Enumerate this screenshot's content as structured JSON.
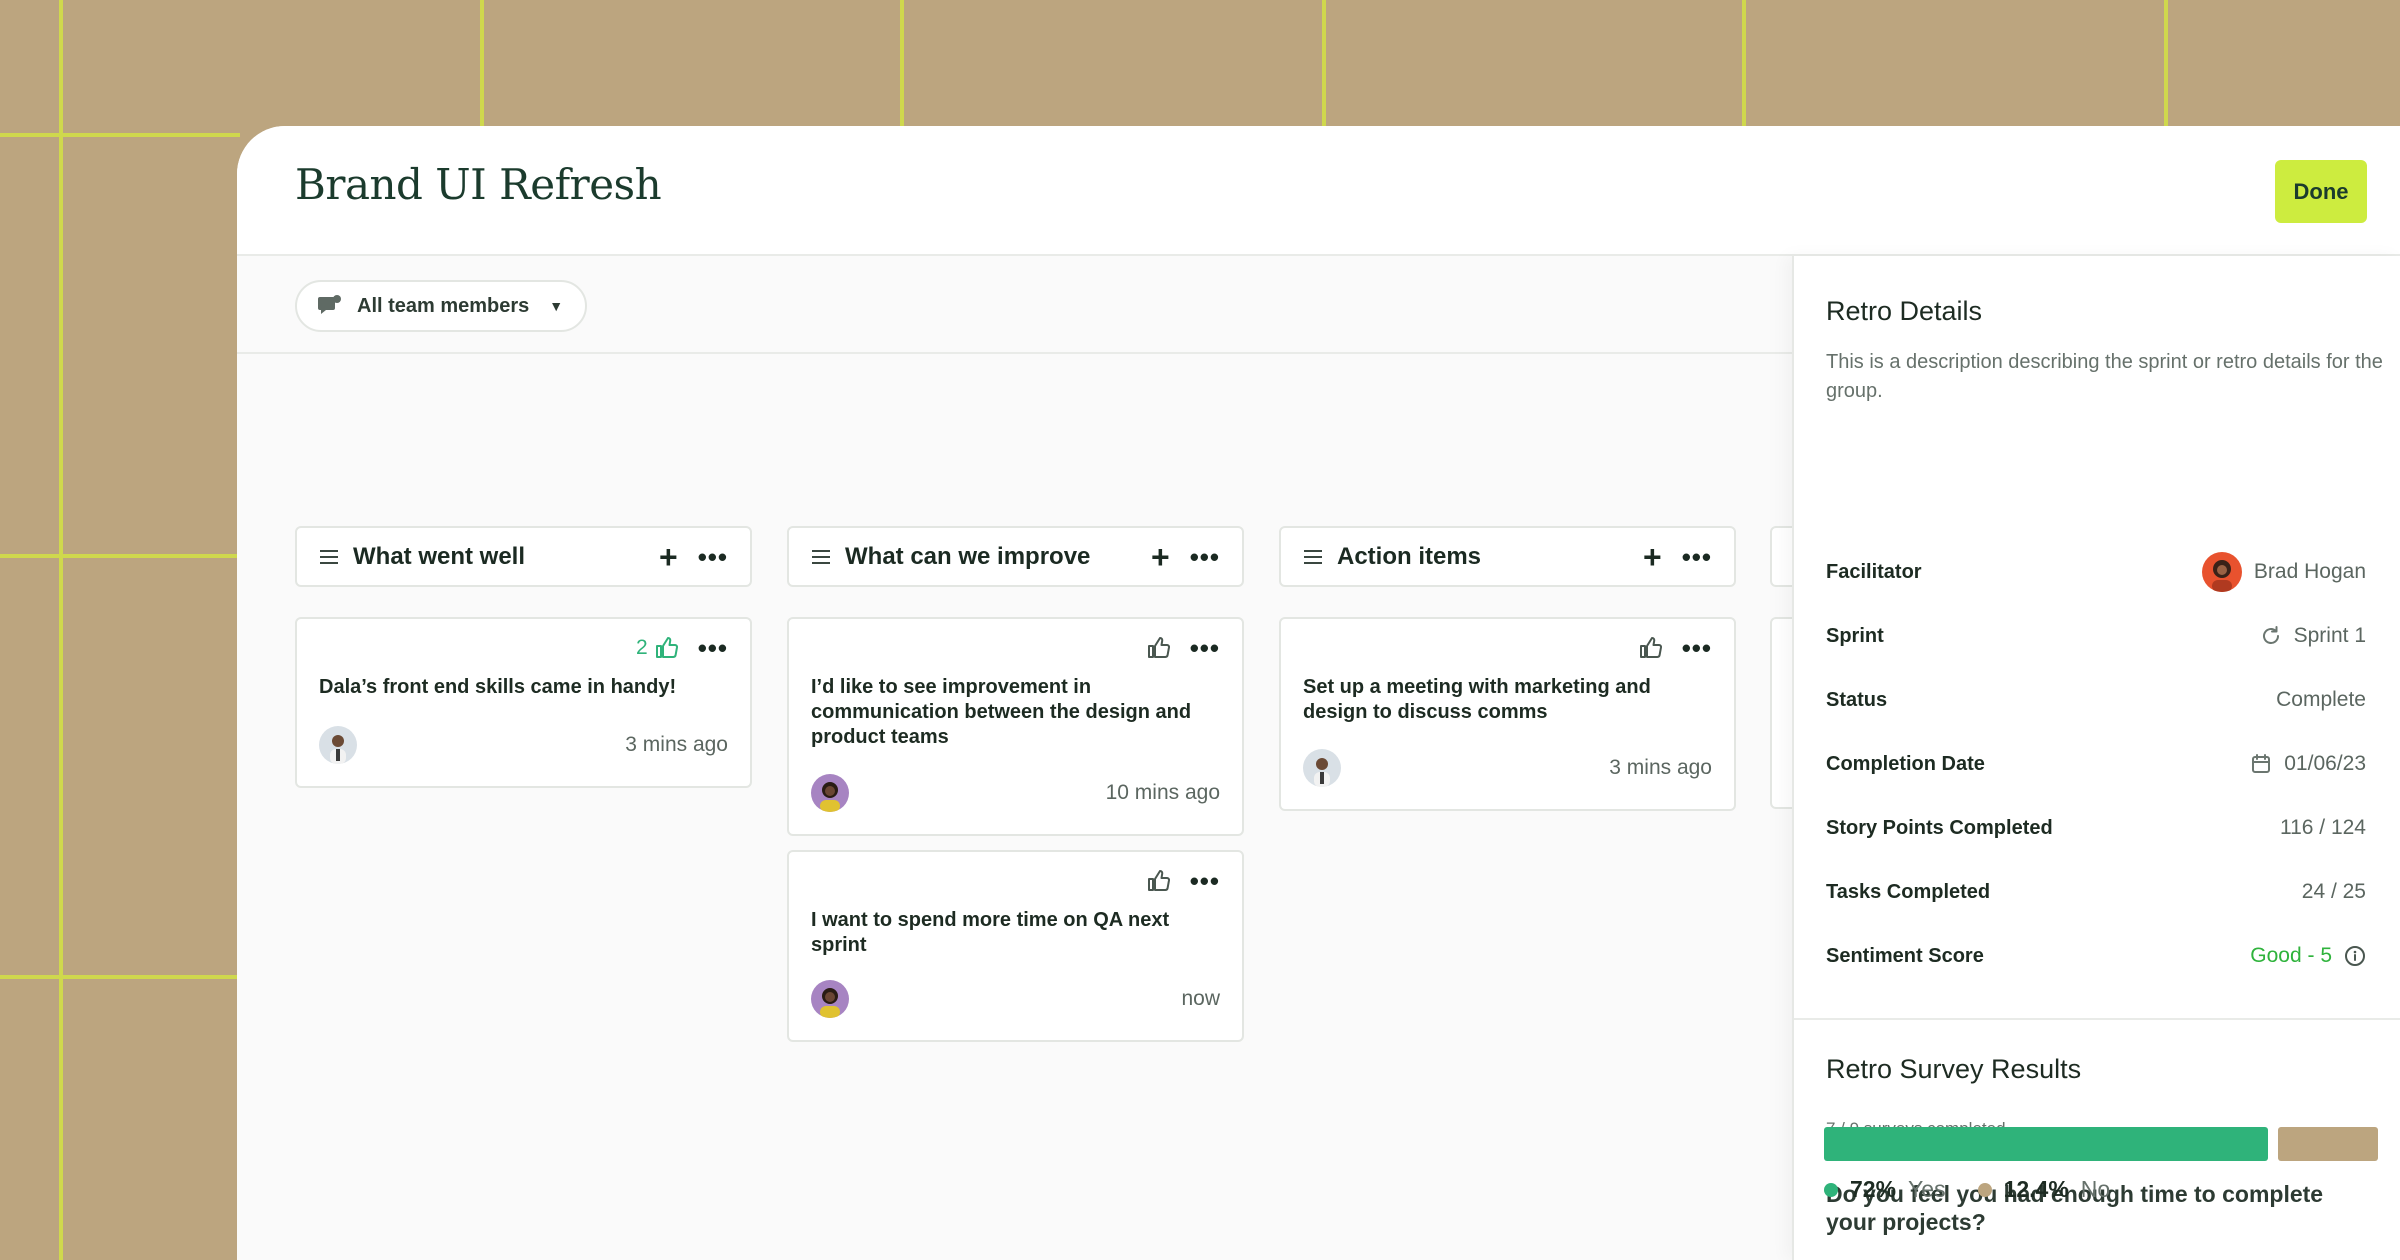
{
  "board": {
    "title": "Brand UI Refresh",
    "done_label": "Done",
    "filter_label": "All team members"
  },
  "columns": [
    {
      "title": "What went well",
      "cards": [
        {
          "text": "Dala’s front end skills came in handy!",
          "time": "3 mins ago",
          "likes": "2",
          "avatar": "man-light-shirt"
        }
      ]
    },
    {
      "title": "What can we improve",
      "cards": [
        {
          "text": "I’d like to see improvement in communication between the design and product teams",
          "time": "10 mins ago",
          "likes": "",
          "avatar": "woman-purple-bg"
        },
        {
          "text": "I want to spend more time on QA next sprint",
          "time": "now",
          "likes": "",
          "avatar": "woman-purple-bg"
        }
      ]
    },
    {
      "title": "Action items",
      "cards": [
        {
          "text": "Set up a meeting with marketing and design to discuss comms",
          "time": "3 mins ago",
          "likes": "",
          "avatar": "man-light-shirt"
        }
      ]
    }
  ],
  "retro_details": {
    "title": "Retro Details",
    "description": "This is a description describing the sprint or retro details for the group.",
    "rows": [
      {
        "label": "Facilitator",
        "value": "Brad Hogan",
        "icon": "avatar"
      },
      {
        "label": "Sprint",
        "value": "Sprint 1",
        "icon": "refresh-icon"
      },
      {
        "label": "Status",
        "value": "Complete",
        "icon": ""
      },
      {
        "label": "Completion Date",
        "value": "01/06/23",
        "icon": "calendar-icon"
      },
      {
        "label": "Story Points Completed",
        "value": "116 / 124",
        "icon": ""
      },
      {
        "label": "Tasks Completed",
        "value": "24 / 25",
        "icon": ""
      },
      {
        "label": "Sentiment Score",
        "value": "Good - 5",
        "icon": "info-icon"
      }
    ]
  },
  "survey": {
    "title": "Retro Survey Results",
    "completed": "7 / 9 surveys completed",
    "question": "Do you feel you had enough time to complete your projects?",
    "yes_pct": "72%",
    "yes_label": "Yes",
    "no_pct": "12.4%",
    "no_label": "No",
    "yes_value": 72,
    "no_value": 12.4
  },
  "colors": {
    "accent": "#cdec3f",
    "brand_green": "#2fb37a",
    "tan": "#bca57f",
    "good": "#2fb33c"
  }
}
